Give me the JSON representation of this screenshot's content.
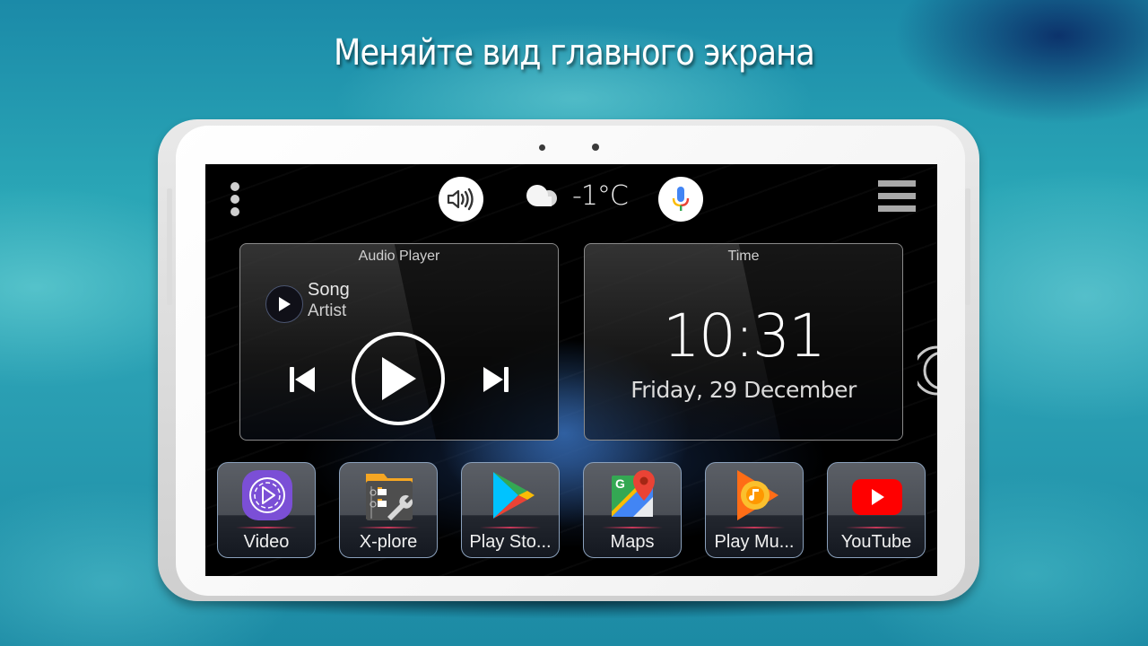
{
  "headline": "Меняйте вид главного экрана",
  "topbar": {
    "menu_dots_icon": "more-vert-icon",
    "volume_icon": "volume-icon",
    "weather_icon": "cloud-icon",
    "temperature": "-1°C",
    "voice_icon": "microphone-icon",
    "hamburger_icon": "hamburger-menu-icon"
  },
  "audio_widget": {
    "title": "Audio Player",
    "song": "Song",
    "artist": "Artist",
    "controls": [
      "previous",
      "play",
      "next"
    ]
  },
  "time_widget": {
    "title": "Time",
    "time": "10:31",
    "date": "Friday, 29 December"
  },
  "dock": {
    "apps": [
      {
        "label": "Video",
        "icon": "video-icon",
        "color": "#7b4fd6"
      },
      {
        "label": "X-plore",
        "icon": "xplore-icon",
        "color": "#f5a623"
      },
      {
        "label": "Play Sto...",
        "icon": "play-store-icon",
        "color": "#34a853"
      },
      {
        "label": "Maps",
        "icon": "maps-icon",
        "color": "#ea4335"
      },
      {
        "label": "Play Mu...",
        "icon": "play-music-icon",
        "color": "#ff9800"
      },
      {
        "label": "YouTube",
        "icon": "youtube-icon",
        "color": "#ff0000"
      }
    ]
  }
}
